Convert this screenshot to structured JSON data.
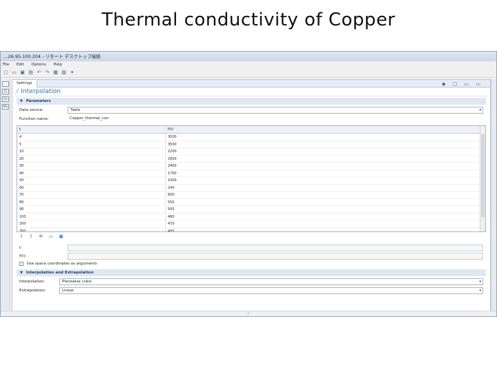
{
  "slide": {
    "title": "Thermal conductivity of Copper"
  },
  "window": {
    "title": "…26.95.100.204 - リモート デスクトップ接続",
    "menu": [
      "File",
      "Edit",
      "Options",
      "Help"
    ],
    "toolbar_icons": [
      "new-icon",
      "open-icon",
      "save-icon",
      "save-all-icon",
      "undo-icon",
      "redo-icon",
      "model-builder-icon",
      "graphics-icon",
      "build-icon"
    ]
  },
  "left_strip": [
    "...",
    "Gr",
    "Ge",
    "Mo"
  ],
  "tab": {
    "label": "Settings",
    "tools": "◆ ▢ ▭ ▭"
  },
  "heading": {
    "icon": "interpolation-icon",
    "text": "Interpolation"
  },
  "parameters": {
    "header": "Parameters",
    "data_source_label": "Data source:",
    "data_source_value": "Table",
    "function_name_label": "Function name:",
    "function_name_value": "Copper_thermal_con",
    "table": {
      "columns": [
        "t",
        "f(t)"
      ],
      "rows": [
        [
          "4",
          "3000"
        ],
        [
          "5",
          "3500"
        ],
        [
          "10",
          "2200"
        ],
        [
          "20",
          "2900"
        ],
        [
          "30",
          "2400"
        ],
        [
          "40",
          "1700"
        ],
        [
          "50",
          "1000"
        ],
        [
          "60",
          "240"
        ],
        [
          "70",
          "600"
        ],
        [
          "80",
          "550"
        ],
        [
          "90",
          "500"
        ],
        [
          "100",
          "460"
        ],
        [
          "200",
          "470"
        ],
        [
          "300",
          "400"
        ]
      ]
    },
    "table_tools": [
      "move-up-icon",
      "move-down-icon",
      "delete-icon",
      "load-icon",
      "save-icon"
    ],
    "t_label": "t:",
    "ft_label": "f(t):",
    "checkbox_label": "Use space coordinates as arguments"
  },
  "interp_extrap": {
    "header": "Interpolation and Extrapolation",
    "interpolation_label": "Interpolation:",
    "interpolation_value": "Piecewise cubic",
    "extrapolation_label": "Extrapolation:",
    "extrapolation_value": "Linear"
  },
  "hscroll_label": "::"
}
